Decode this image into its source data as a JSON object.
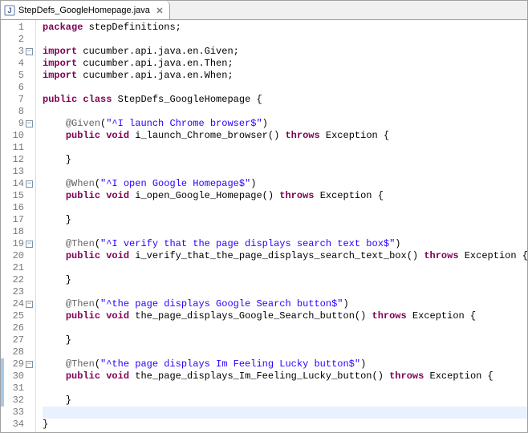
{
  "tab": {
    "filename": "StepDefs_GoogleHomepage.java",
    "iconLetter": "J"
  },
  "code": {
    "lines": [
      {
        "n": 1,
        "marker": false,
        "hl": false,
        "segs": [
          [
            "kw",
            "package"
          ],
          [
            "",
            " stepDefinitions;"
          ]
        ]
      },
      {
        "n": 2,
        "marker": false,
        "hl": false,
        "segs": [
          [
            "",
            ""
          ]
        ]
      },
      {
        "n": 3,
        "marker": true,
        "hl": false,
        "segs": [
          [
            "kw",
            "import"
          ],
          [
            "",
            " cucumber.api.java.en.Given;"
          ]
        ]
      },
      {
        "n": 4,
        "marker": false,
        "hl": false,
        "segs": [
          [
            "kw",
            "import"
          ],
          [
            "",
            " cucumber.api.java.en.Then;"
          ]
        ]
      },
      {
        "n": 5,
        "marker": false,
        "hl": false,
        "segs": [
          [
            "kw",
            "import"
          ],
          [
            "",
            " cucumber.api.java.en.When;"
          ]
        ]
      },
      {
        "n": 6,
        "marker": false,
        "hl": false,
        "segs": [
          [
            "",
            ""
          ]
        ]
      },
      {
        "n": 7,
        "marker": false,
        "hl": false,
        "segs": [
          [
            "kw",
            "public"
          ],
          [
            "",
            " "
          ],
          [
            "kw",
            "class"
          ],
          [
            "",
            " StepDefs_GoogleHomepage {"
          ]
        ]
      },
      {
        "n": 8,
        "marker": false,
        "hl": false,
        "segs": [
          [
            "",
            ""
          ]
        ]
      },
      {
        "n": 9,
        "marker": true,
        "hl": false,
        "segs": [
          [
            "",
            "    "
          ],
          [
            "ann",
            "@Given"
          ],
          [
            "",
            "("
          ],
          [
            "str",
            "\"^I launch Chrome browser$\""
          ],
          [
            "",
            ")"
          ]
        ]
      },
      {
        "n": 10,
        "marker": false,
        "hl": false,
        "segs": [
          [
            "",
            "    "
          ],
          [
            "kw",
            "public"
          ],
          [
            "",
            " "
          ],
          [
            "kw",
            "void"
          ],
          [
            "",
            " i_launch_Chrome_browser() "
          ],
          [
            "kw",
            "throws"
          ],
          [
            "",
            " Exception {"
          ]
        ]
      },
      {
        "n": 11,
        "marker": false,
        "hl": false,
        "segs": [
          [
            "",
            ""
          ]
        ]
      },
      {
        "n": 12,
        "marker": false,
        "hl": false,
        "segs": [
          [
            "",
            "    }"
          ]
        ]
      },
      {
        "n": 13,
        "marker": false,
        "hl": false,
        "segs": [
          [
            "",
            ""
          ]
        ]
      },
      {
        "n": 14,
        "marker": true,
        "hl": false,
        "segs": [
          [
            "",
            "    "
          ],
          [
            "ann",
            "@When"
          ],
          [
            "",
            "("
          ],
          [
            "str",
            "\"^I open Google Homepage$\""
          ],
          [
            "",
            ")"
          ]
        ]
      },
      {
        "n": 15,
        "marker": false,
        "hl": false,
        "segs": [
          [
            "",
            "    "
          ],
          [
            "kw",
            "public"
          ],
          [
            "",
            " "
          ],
          [
            "kw",
            "void"
          ],
          [
            "",
            " i_open_Google_Homepage() "
          ],
          [
            "kw",
            "throws"
          ],
          [
            "",
            " Exception {"
          ]
        ]
      },
      {
        "n": 16,
        "marker": false,
        "hl": false,
        "segs": [
          [
            "",
            ""
          ]
        ]
      },
      {
        "n": 17,
        "marker": false,
        "hl": false,
        "segs": [
          [
            "",
            "    }"
          ]
        ]
      },
      {
        "n": 18,
        "marker": false,
        "hl": false,
        "segs": [
          [
            "",
            ""
          ]
        ]
      },
      {
        "n": 19,
        "marker": true,
        "hl": false,
        "segs": [
          [
            "",
            "    "
          ],
          [
            "ann",
            "@Then"
          ],
          [
            "",
            "("
          ],
          [
            "str",
            "\"^I verify that the page displays search text box$\""
          ],
          [
            "",
            ")"
          ]
        ]
      },
      {
        "n": 20,
        "marker": false,
        "hl": false,
        "segs": [
          [
            "",
            "    "
          ],
          [
            "kw",
            "public"
          ],
          [
            "",
            " "
          ],
          [
            "kw",
            "void"
          ],
          [
            "",
            " i_verify_that_the_page_displays_search_text_box() "
          ],
          [
            "kw",
            "throws"
          ],
          [
            "",
            " Exception {"
          ]
        ]
      },
      {
        "n": 21,
        "marker": false,
        "hl": false,
        "segs": [
          [
            "",
            ""
          ]
        ]
      },
      {
        "n": 22,
        "marker": false,
        "hl": false,
        "segs": [
          [
            "",
            "    }"
          ]
        ]
      },
      {
        "n": 23,
        "marker": false,
        "hl": false,
        "segs": [
          [
            "",
            ""
          ]
        ]
      },
      {
        "n": 24,
        "marker": true,
        "hl": false,
        "segs": [
          [
            "",
            "    "
          ],
          [
            "ann",
            "@Then"
          ],
          [
            "",
            "("
          ],
          [
            "str",
            "\"^the page displays Google Search button$\""
          ],
          [
            "",
            ")"
          ]
        ]
      },
      {
        "n": 25,
        "marker": false,
        "hl": false,
        "segs": [
          [
            "",
            "    "
          ],
          [
            "kw",
            "public"
          ],
          [
            "",
            " "
          ],
          [
            "kw",
            "void"
          ],
          [
            "",
            " the_page_displays_Google_Search_button() "
          ],
          [
            "kw",
            "throws"
          ],
          [
            "",
            " Exception {"
          ]
        ]
      },
      {
        "n": 26,
        "marker": false,
        "hl": false,
        "segs": [
          [
            "",
            ""
          ]
        ]
      },
      {
        "n": 27,
        "marker": false,
        "hl": false,
        "segs": [
          [
            "",
            "    }"
          ]
        ]
      },
      {
        "n": 28,
        "marker": false,
        "hl": false,
        "segs": [
          [
            "",
            ""
          ]
        ]
      },
      {
        "n": 29,
        "marker": true,
        "hl": true,
        "segs": [
          [
            "",
            "    "
          ],
          [
            "ann",
            "@Then"
          ],
          [
            "",
            "("
          ],
          [
            "str",
            "\"^the page displays Im Feeling Lucky button$\""
          ],
          [
            "",
            ")"
          ]
        ]
      },
      {
        "n": 30,
        "marker": false,
        "hl": true,
        "segs": [
          [
            "",
            "    "
          ],
          [
            "kw",
            "public"
          ],
          [
            "",
            " "
          ],
          [
            "kw",
            "void"
          ],
          [
            "",
            " the_page_displays_Im_Feeling_Lucky_button() "
          ],
          [
            "kw",
            "throws"
          ],
          [
            "",
            " Exception {"
          ]
        ]
      },
      {
        "n": 31,
        "marker": false,
        "hl": true,
        "segs": [
          [
            "",
            ""
          ]
        ]
      },
      {
        "n": 32,
        "marker": false,
        "hl": true,
        "segs": [
          [
            "",
            "    }"
          ]
        ]
      },
      {
        "n": 33,
        "marker": false,
        "hl": false,
        "segs": [
          [
            "",
            ""
          ]
        ]
      },
      {
        "n": 34,
        "marker": false,
        "hl": false,
        "segs": [
          [
            "",
            "}"
          ]
        ]
      }
    ]
  }
}
